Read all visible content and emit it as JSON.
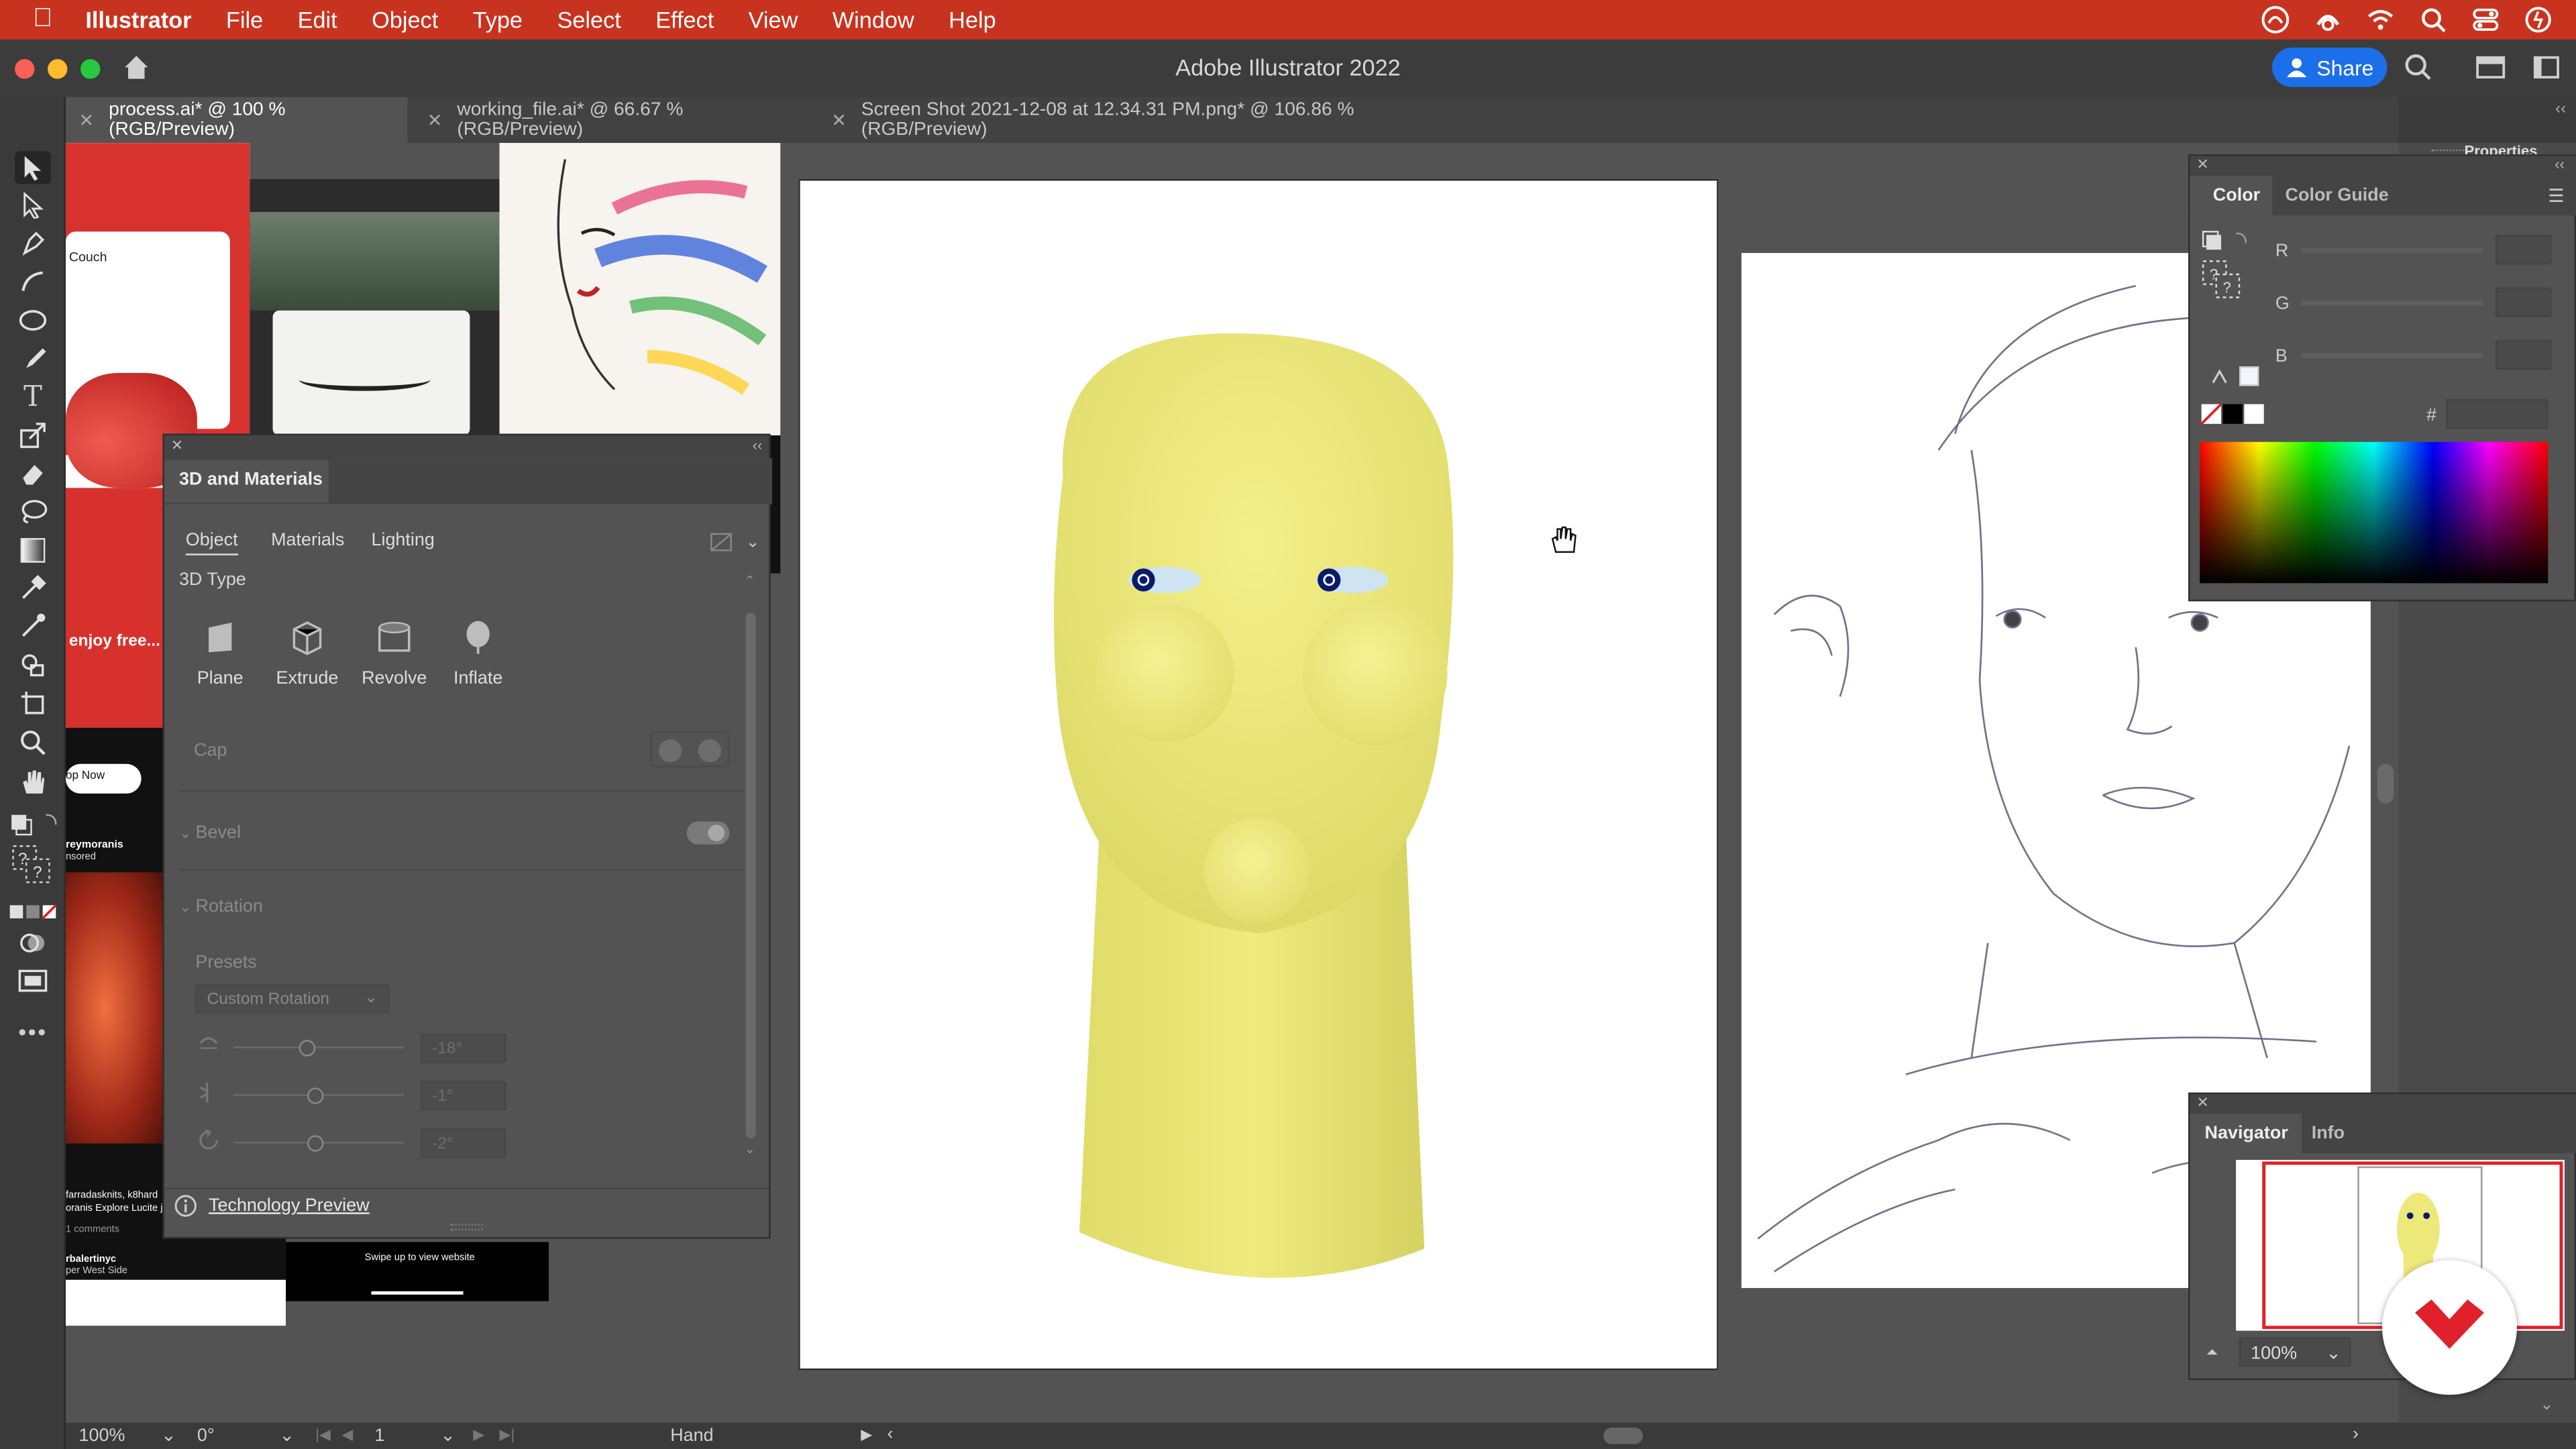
{
  "menubar": {
    "app_name": "Illustrator",
    "items": [
      "File",
      "Edit",
      "Object",
      "Type",
      "Select",
      "Effect",
      "View",
      "Window",
      "Help"
    ]
  },
  "window": {
    "title": "Adobe Illustrator 2022",
    "share_label": "Share"
  },
  "tabs": [
    {
      "label": "process.ai* @ 100 % (RGB/Preview)",
      "active": true
    },
    {
      "label": "working_file.ai* @ 66.67 % (RGB/Preview)",
      "active": false
    },
    {
      "label": "Screen Shot 2021-12-08 at 12.34.31 PM.png* @ 106.86 % (RGB/Preview)",
      "active": false
    }
  ],
  "background_photos": {
    "couch_label": "Couch",
    "enjoy_text": "enjoy free...",
    "shop_now": "op Now",
    "username1": "reymoranis",
    "username1_sub": "nsored",
    "comment_line1": "farradasknits, k8hard",
    "comment_line2": "oranis Explore Lucite je",
    "comments": "1 comments",
    "username2": "rbalertinyc",
    "username2_sub": "per West Side",
    "swipe_text": "Swipe up to view website"
  },
  "panel_3d": {
    "title": "3D and Materials",
    "tabs": [
      "Object",
      "Materials",
      "Lighting"
    ],
    "section_3d_type": "3D Type",
    "types": [
      "Plane",
      "Extrude",
      "Revolve",
      "Inflate"
    ],
    "cap_label": "Cap",
    "bevel_label": "Bevel",
    "rotation_label": "Rotation",
    "presets_label": "Presets",
    "preset_value": "Custom Rotation",
    "rot_x": "-18°",
    "rot_y": "-1°",
    "rot_z": "-2°",
    "footer_link": "Technology Preview"
  },
  "color_panel": {
    "tabs": [
      "Color",
      "Color Guide"
    ],
    "channels": [
      "R",
      "G",
      "B"
    ],
    "hex_label": "#"
  },
  "navigator_panel": {
    "tabs": [
      "Navigator",
      "Info"
    ],
    "zoom": "100%"
  },
  "properties_label": "Properties",
  "statusbar": {
    "zoom": "100%",
    "rotation": "0°",
    "artboard": "1",
    "tool": "Hand"
  },
  "colors": {
    "menubar": "#c8331f",
    "head_yellow": "#ece87a",
    "share_blue": "#1b6fe8",
    "eye_navy": "#0a1a6e",
    "nav_red": "#e0202a"
  }
}
